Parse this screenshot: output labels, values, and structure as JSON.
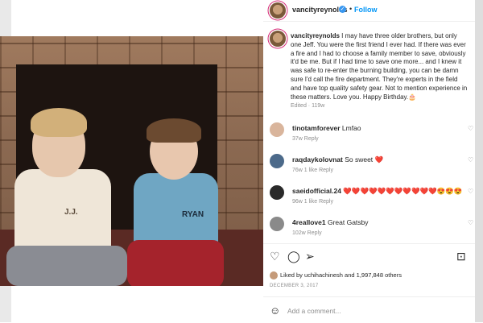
{
  "post": {
    "username": "vancityreynolds",
    "follow_label": "Follow",
    "verified_mark": "✓",
    "dot": "•"
  },
  "photo": {
    "shirt_left": "J.J.",
    "shirt_right": "RYAN"
  },
  "caption": {
    "username": "vancityreynolds",
    "text": "I may have three older brothers, but only one Jeff. You were the first friend I ever had. If there was ever a fire and I had to choose a family member to save, obviously it'd be me. But if I had time to save one more... and I knew it was safe to re-enter the burning building, you can be damn sure I'd call the fire department. They're experts in the field and have top quality safety gear. Not to mention experience in these matters. Love you. Happy Birthday.🎂",
    "meta": "Edited · 119w"
  },
  "comments": [
    {
      "user": "tinotamforever",
      "text": "Lmfao",
      "meta": "37w  Reply",
      "avatar_color": "#d9b59c"
    },
    {
      "user": "raqdaykolovnat",
      "text": "So sweet ❤️",
      "meta": "76w  1 like  Reply",
      "avatar_color": "#4c6a8a"
    },
    {
      "user": "saeidofficial.24",
      "text": "❤️❤️❤️❤️❤️❤️❤️❤️❤️❤️❤️😍😍😍",
      "meta": "96w  1 like  Reply",
      "avatar_color": "#2a2a2a"
    },
    {
      "user": "4reallove1",
      "text": "Great Gatsby",
      "meta": "102w  Reply",
      "avatar_color": "#8a8a8a"
    }
  ],
  "likes_text": "Liked by uchihachinesh and 1,997,848 others",
  "date": "DECEMBER 3, 2017",
  "add_comment_placeholder": "Add a comment...",
  "icons": {
    "heart": "heart-icon",
    "comment": "comment-icon",
    "share": "share-icon",
    "save": "bookmark-icon",
    "emoji": "emoji-icon"
  },
  "colors": {
    "accent": "#0095f6",
    "verified": "#3897f0",
    "muted": "#8e8e8e"
  }
}
